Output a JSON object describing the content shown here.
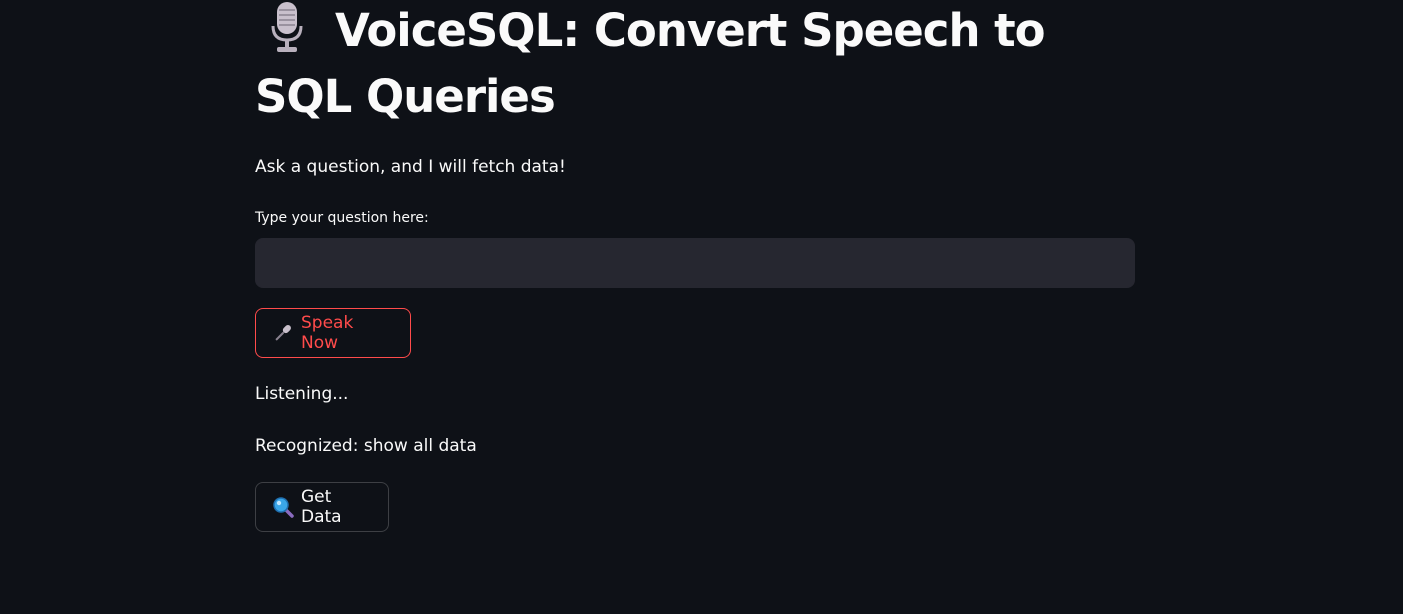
{
  "title": {
    "icon": "microphone-icon",
    "text": "VoiceSQL: Convert Speech to SQL Queries"
  },
  "subtitle": "Ask a question, and I will fetch data!",
  "question_input": {
    "label": "Type your question here:",
    "value": "",
    "placeholder": ""
  },
  "speak_button": {
    "icon": "microphone-icon",
    "label": "Speak Now"
  },
  "status": {
    "listening": "Listening...",
    "recognized": "Recognized: show all data"
  },
  "get_data_button": {
    "icon": "magnifier-icon",
    "label": "Get Data"
  },
  "colors": {
    "background": "#0e1117",
    "input_background": "#262730",
    "text": "#fafafa",
    "accent": "#ff4b4b"
  }
}
